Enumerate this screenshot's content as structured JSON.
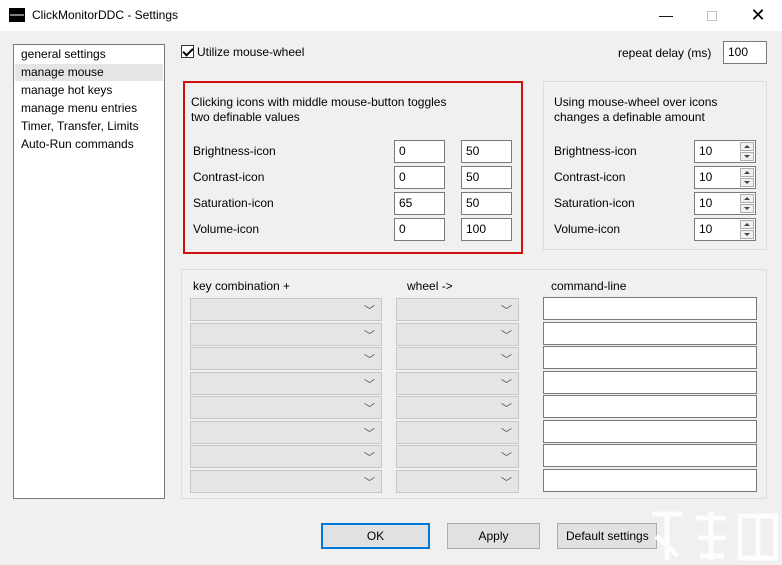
{
  "window": {
    "title": "ClickMonitorDDC - Settings"
  },
  "nav": {
    "items": [
      {
        "label": "general settings",
        "selected": false
      },
      {
        "label": "manage mouse",
        "selected": true
      },
      {
        "label": "manage hot keys",
        "selected": false
      },
      {
        "label": "manage menu entries",
        "selected": false
      },
      {
        "label": "Timer, Transfer, Limits",
        "selected": false
      },
      {
        "label": "Auto-Run commands",
        "selected": false
      }
    ]
  },
  "mouse_wheel": {
    "label": "Utilize mouse-wheel",
    "checked": true
  },
  "repeat_delay": {
    "label": "repeat delay (ms)",
    "value": "100"
  },
  "middle_click_group": {
    "description_line1": "Clicking icons with middle mouse-button toggles",
    "description_line2": "two definable values",
    "rows": [
      {
        "label": "Brightness-icon",
        "value1": "0",
        "value2": "50"
      },
      {
        "label": "Contrast-icon",
        "value1": "0",
        "value2": "50"
      },
      {
        "label": "Saturation-icon",
        "value1": "65",
        "value2": "50"
      },
      {
        "label": "Volume-icon",
        "value1": "0",
        "value2": "100"
      }
    ]
  },
  "wheel_group": {
    "description_line1": "Using mouse-wheel over icons",
    "description_line2": "changes a definable amount",
    "rows": [
      {
        "label": "Brightness-icon",
        "value": "10"
      },
      {
        "label": "Contrast-icon",
        "value": "10"
      },
      {
        "label": "Saturation-icon",
        "value": "10"
      },
      {
        "label": "Volume-icon",
        "value": "10"
      }
    ]
  },
  "commands_table": {
    "headers": {
      "key_combination": "key combination  +",
      "wheel": "wheel  ->",
      "command_line": "command-line"
    },
    "row_count": 8,
    "dropdown_icon": "chevron-down-icon"
  },
  "buttons": {
    "ok": "OK",
    "apply": "Apply",
    "default_settings": "Default settings"
  },
  "colors": {
    "highlight_border": "#d01010",
    "default_button_border": "#0078d7"
  }
}
